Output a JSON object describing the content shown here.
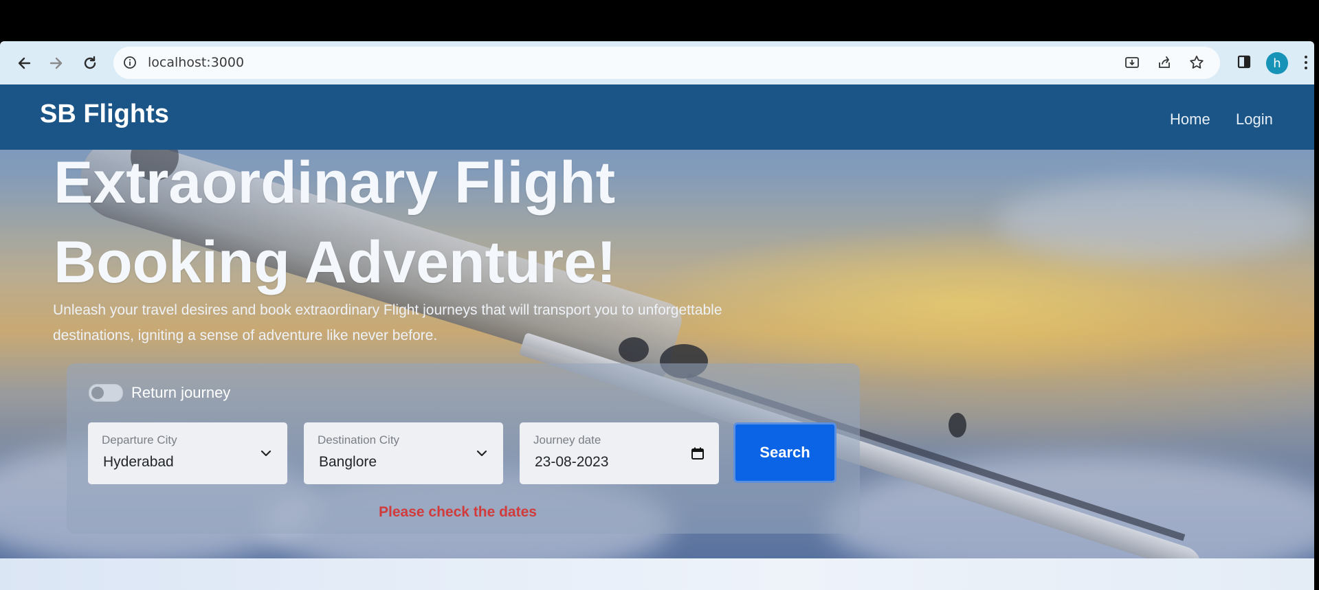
{
  "browser": {
    "url": "localhost:3000",
    "profile_initial": "h",
    "icons": [
      "back-arrow-icon",
      "forward-arrow-icon",
      "reload-icon",
      "info-icon",
      "install-icon",
      "share-icon",
      "star-icon",
      "side-panel-icon",
      "more-vert-icon"
    ]
  },
  "navbar": {
    "brand": "SB Flights",
    "links": [
      "Home",
      "Login"
    ]
  },
  "hero": {
    "title_line1": "Extraordinary Flight",
    "title_line2": "Booking Adventure!",
    "subtitle_line1": "Unleash your travel desires and book extraordinary Flight journeys that will transport you to unforgettable",
    "subtitle_line2": "destinations, igniting a sense of adventure like never before."
  },
  "search": {
    "return_journey_label": "Return journey",
    "return_journey_checked": false,
    "departure": {
      "label": "Departure City",
      "value": "Hyderabad"
    },
    "destination": {
      "label": "Destination City",
      "value": "Banglore"
    },
    "journey_date": {
      "label": "Journey date",
      "value": "23-08-2023"
    },
    "search_label": "Search",
    "error": "Please check the dates"
  },
  "colors": {
    "navbar": "#1b5587",
    "search_button": "#0b63e5",
    "error": "#d23b3b"
  }
}
